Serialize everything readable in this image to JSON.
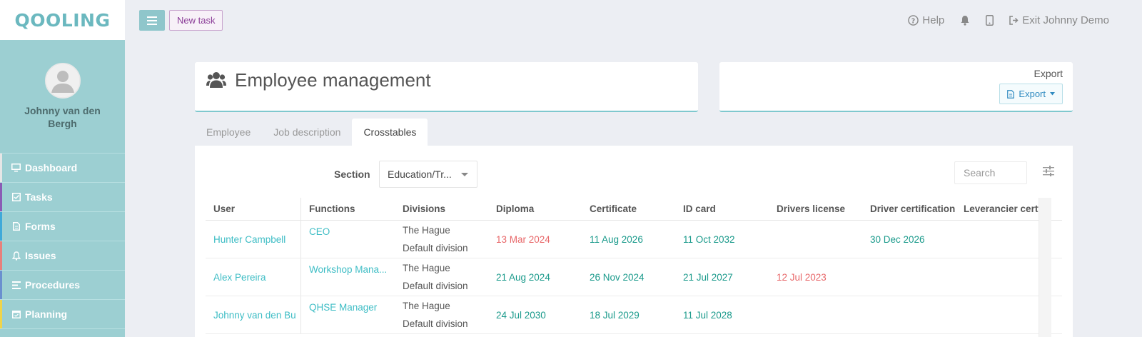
{
  "app": {
    "logo": "QOOLING"
  },
  "topbar": {
    "new_task_label": "New task",
    "help_label": "Help",
    "exit_label": "Exit Johnny Demo"
  },
  "sidebar": {
    "user_name": "Johnny van den Bergh",
    "items": [
      {
        "label": "Dashboard",
        "color": "#e6e6e6",
        "icon": "monitor-icon"
      },
      {
        "label": "Tasks",
        "color": "#8a5bb5",
        "icon": "checkbox-icon"
      },
      {
        "label": "Forms",
        "color": "#3fa9d9",
        "icon": "document-icon"
      },
      {
        "label": "Issues",
        "color": "#e8807b",
        "icon": "bell-icon"
      },
      {
        "label": "Procedures",
        "color": "#6a8fcf",
        "icon": "list-icon"
      },
      {
        "label": "Planning",
        "color": "#f0d44a",
        "icon": "calendar-icon"
      }
    ]
  },
  "page": {
    "title": "Employee management",
    "export_label": "Export",
    "export_button": "Export"
  },
  "tabs": [
    {
      "label": "Employee",
      "active": false
    },
    {
      "label": "Job description",
      "active": false
    },
    {
      "label": "Crosstables",
      "active": true
    }
  ],
  "filters": {
    "section_label": "Section",
    "section_value": "Education/Tr...",
    "search_placeholder": "Search"
  },
  "table": {
    "columns": [
      "User",
      "Functions",
      "Divisions",
      "Diploma",
      "Certificate",
      "ID card",
      "Drivers license",
      "Driver certification",
      "Leverancier certfi..."
    ],
    "rows": [
      {
        "user": "Hunter Campbell",
        "function": "CEO",
        "division_1": "The Hague",
        "division_2": "Default division",
        "diploma": "13 Mar 2024",
        "certificate": "11 Aug 2026",
        "id_card": "11 Oct 2032",
        "drivers_license": "",
        "driver_cert": "30 Dec 2026",
        "leverancier": ""
      },
      {
        "user": "Alex Pereira",
        "function": "Workshop Mana...",
        "division_1": "The Hague",
        "division_2": "Default division",
        "diploma": "21 Aug 2024",
        "certificate": "26 Nov 2024",
        "id_card": "21 Jul 2027",
        "drivers_license": "12 Jul 2023",
        "driver_cert": "",
        "leverancier": ""
      },
      {
        "user": "Johnny van den Bu",
        "function": "QHSE Manager",
        "division_1": "The Hague",
        "division_2": "Default division",
        "diploma": "24 Jul 2030",
        "certificate": "18 Jul 2029",
        "id_card": "11 Jul 2028",
        "drivers_license": "",
        "driver_cert": "",
        "leverancier": ""
      }
    ]
  },
  "colors": {
    "accent": "#9ccfd2",
    "ok": "#1a9a8b",
    "expired": "#e8686a",
    "link": "#3ebdc5"
  }
}
